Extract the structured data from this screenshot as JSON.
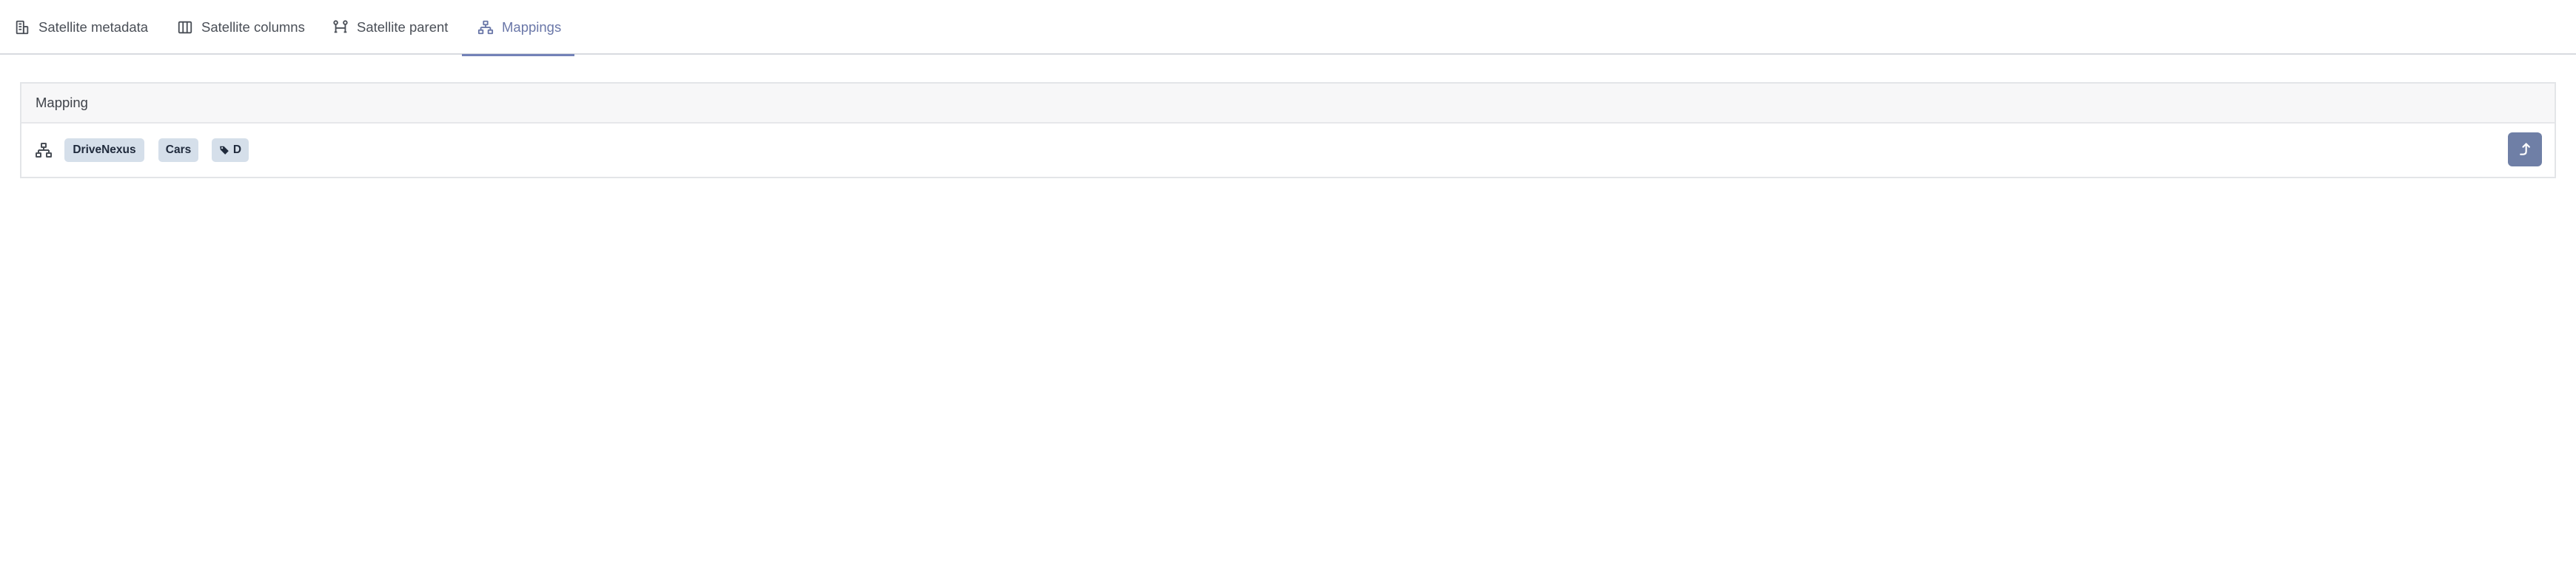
{
  "tabs": [
    {
      "label": "Satellite metadata",
      "icon": "building-icon",
      "active": false
    },
    {
      "label": "Satellite columns",
      "icon": "columns-icon",
      "active": false
    },
    {
      "label": "Satellite parent",
      "icon": "hierarchy-link-icon",
      "active": false
    },
    {
      "label": "Mappings",
      "icon": "sitemap-icon",
      "active": true
    }
  ],
  "panel": {
    "header": "Mapping",
    "row": {
      "icon": "sitemap-icon",
      "badges": [
        "DriveNexus",
        "Cars",
        "D"
      ],
      "tag_icon": "tag-icon",
      "action_icon": "level-up-arrow-icon"
    }
  },
  "colors": {
    "accent": "#7382b8",
    "active_tab_text": "#6a77a8",
    "badge_bg": "#d5dfea",
    "button_bg": "#6f7fa6"
  }
}
